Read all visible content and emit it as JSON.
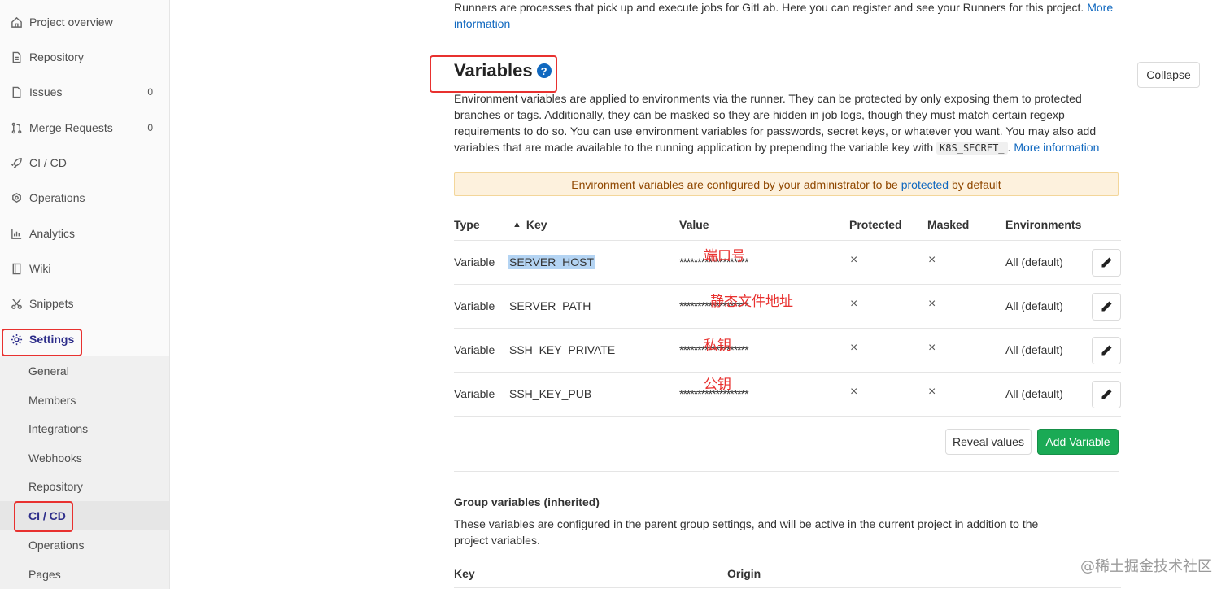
{
  "sidebar": {
    "items": [
      {
        "label": "Project overview",
        "icon": "home-icon"
      },
      {
        "label": "Repository",
        "icon": "doc-icon"
      },
      {
        "label": "Issues",
        "icon": "issues-icon",
        "count": "0"
      },
      {
        "label": "Merge Requests",
        "icon": "merge-icon",
        "count": "0"
      },
      {
        "label": "CI / CD",
        "icon": "rocket-icon"
      },
      {
        "label": "Operations",
        "icon": "cloud-icon"
      },
      {
        "label": "Analytics",
        "icon": "chart-icon"
      },
      {
        "label": "Wiki",
        "icon": "book-icon"
      },
      {
        "label": "Snippets",
        "icon": "scissors-icon"
      },
      {
        "label": "Settings",
        "icon": "gear-icon"
      }
    ],
    "settings_sub": [
      "General",
      "Members",
      "Integrations",
      "Webhooks",
      "Repository",
      "CI / CD",
      "Operations",
      "Pages"
    ]
  },
  "runners": {
    "text": "Runners are processes that pick up and execute jobs for GitLab. Here you can register and see your Runners for this project.",
    "more_link": "More information"
  },
  "variables": {
    "title": "Variables",
    "help": "?",
    "collapse_label": "Collapse",
    "description": "Environment variables are applied to environments via the runner. They can be protected by only exposing them to protected branches or tags. Additionally, they can be masked so they are hidden in job logs, though they must match certain regexp requirements to do so. You can use environment variables for passwords, secret keys, or whatever you want. You may also add variables that are made available to the running application by prepending the variable key with",
    "code": "K8S_SECRET_",
    "after_code": ".",
    "more_link": "More information",
    "warning_pre": "Environment variables are configured by your administrator to be",
    "warning_link": "protected",
    "warning_post": "by default",
    "columns": [
      "Type",
      "Key",
      "Value",
      "Protected",
      "Masked",
      "Environments"
    ],
    "sort_icon": "sort-icon",
    "rows": [
      {
        "type": "Variable",
        "key": "SERVER_HOST",
        "value": "*******************",
        "protected": "×",
        "masked": "×",
        "env": "All (default)",
        "note": "端口号"
      },
      {
        "type": "Variable",
        "key": "SERVER_PATH",
        "value": "*******************",
        "protected": "×",
        "masked": "×",
        "env": "All (default)",
        "note": "静态文件地址"
      },
      {
        "type": "Variable",
        "key": "SSH_KEY_PRIVATE",
        "value": "*******************",
        "protected": "×",
        "masked": "×",
        "env": "All (default)",
        "note": "私钥"
      },
      {
        "type": "Variable",
        "key": "SSH_KEY_PUB",
        "value": "*******************",
        "protected": "×",
        "masked": "×",
        "env": "All (default)",
        "note": "公钥"
      }
    ],
    "reveal_label": "Reveal values",
    "add_label": "Add Variable"
  },
  "group": {
    "title": "Group variables (inherited)",
    "description": "These variables are configured in the parent group settings, and will be active in the current project in addition to the project variables.",
    "columns": [
      "Key",
      "Origin"
    ]
  },
  "watermark": "@稀土掘金技术社区",
  "colors": {
    "accent": "#1068bf",
    "success": "#1aaa55",
    "annotation": "#e8312f",
    "warning_bg": "#fdf1dd"
  }
}
